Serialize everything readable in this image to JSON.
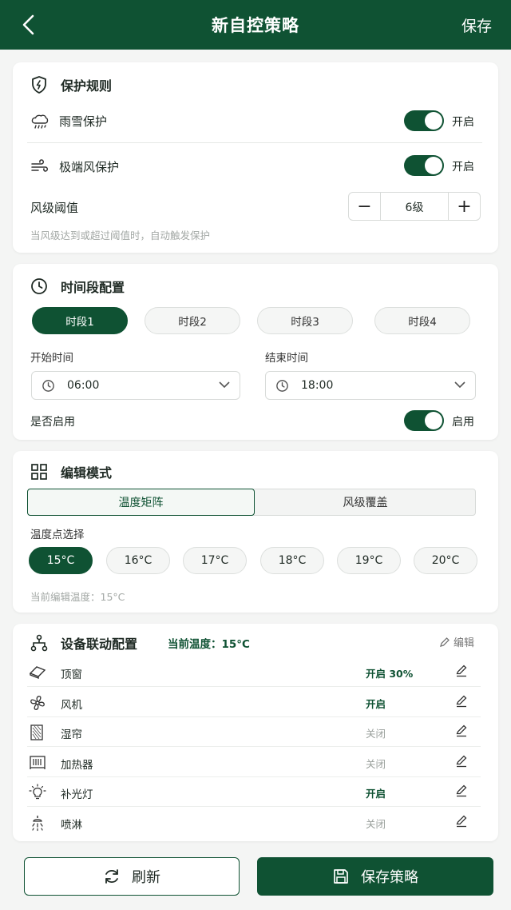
{
  "header": {
    "title": "新自控策略",
    "save_label": "保存"
  },
  "protection": {
    "title": "保护规则",
    "rain_label": "雨雪保护",
    "rain_state": "开启",
    "wind_label": "极端风保护",
    "wind_state": "开启",
    "threshold_label": "风级阈值",
    "threshold_value": "6级",
    "hint": "当风级达到或超过阈值时，自动触发保护"
  },
  "timeslot": {
    "title": "时间段配置",
    "slots": [
      "时段1",
      "时段2",
      "时段3",
      "时段4"
    ],
    "start_label": "开始时间",
    "start_value": "06:00",
    "end_label": "结束时间",
    "end_value": "18:00",
    "enable_label": "是否启用",
    "enable_state": "启用"
  },
  "edit_mode": {
    "title": "编辑模式",
    "tabs": [
      "温度矩阵",
      "风级覆盖"
    ],
    "temp_label": "温度点选择",
    "temps": [
      "15°C",
      "16°C",
      "17°C",
      "18°C",
      "19°C",
      "20°C"
    ],
    "current": "当前编辑温度：15°C"
  },
  "devices": {
    "title": "设备联动配置",
    "current_temp": "当前温度：15°C",
    "edit_label": "编辑",
    "items": [
      {
        "name": "顶窗",
        "status": "开启 30%",
        "on": true,
        "icon": "roof-window-icon"
      },
      {
        "name": "风机",
        "status": "开启",
        "on": true,
        "icon": "fan-icon"
      },
      {
        "name": "湿帘",
        "status": "关闭",
        "on": false,
        "icon": "wet-curtain-icon"
      },
      {
        "name": "加热器",
        "status": "关闭",
        "on": false,
        "icon": "heater-icon"
      },
      {
        "name": "补光灯",
        "status": "开启",
        "on": true,
        "icon": "grow-light-icon"
      },
      {
        "name": "喷淋",
        "status": "关闭",
        "on": false,
        "icon": "sprinkler-icon"
      }
    ]
  },
  "footer": {
    "refresh_label": "刷新",
    "save_label": "保存策略"
  },
  "colors": {
    "primary": "#0f5233",
    "background": "#f4f5f4"
  }
}
